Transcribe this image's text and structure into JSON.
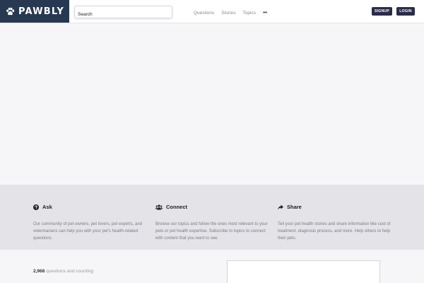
{
  "header": {
    "logo_text": "PAWBLY",
    "search": {
      "placeholder": "Search"
    },
    "nav": {
      "questions": "Questions",
      "stories": "Stories",
      "topics": "Topics",
      "more": "•••"
    },
    "signup_label": "SIGNUP",
    "login_label": "LOGIN"
  },
  "features": [
    {
      "icon": "question-circle-icon",
      "title": "Ask",
      "description": "Our community of pet owners, pet lovers, pet experts, and veterinarians can help you with your pet's health-related questions."
    },
    {
      "icon": "users-icon",
      "title": "Connect",
      "description": "Browse our topics and follow the ones most relevant to your pets or pet health expertise. Subscribe to topics to connect with content that you want to see."
    },
    {
      "icon": "share-icon",
      "title": "Share",
      "description": "Tell your pet health stories and share information like cost of treatment, diagnosis process, and more. Help others to help their pets."
    }
  ],
  "stats": {
    "count": "2,968",
    "label": "questions and counting"
  },
  "colors": {
    "brand_navy": "#273951",
    "button_dark": "#2a2c4a",
    "band_gray": "#e3e3e8",
    "page_bg": "#f6f6f8"
  }
}
